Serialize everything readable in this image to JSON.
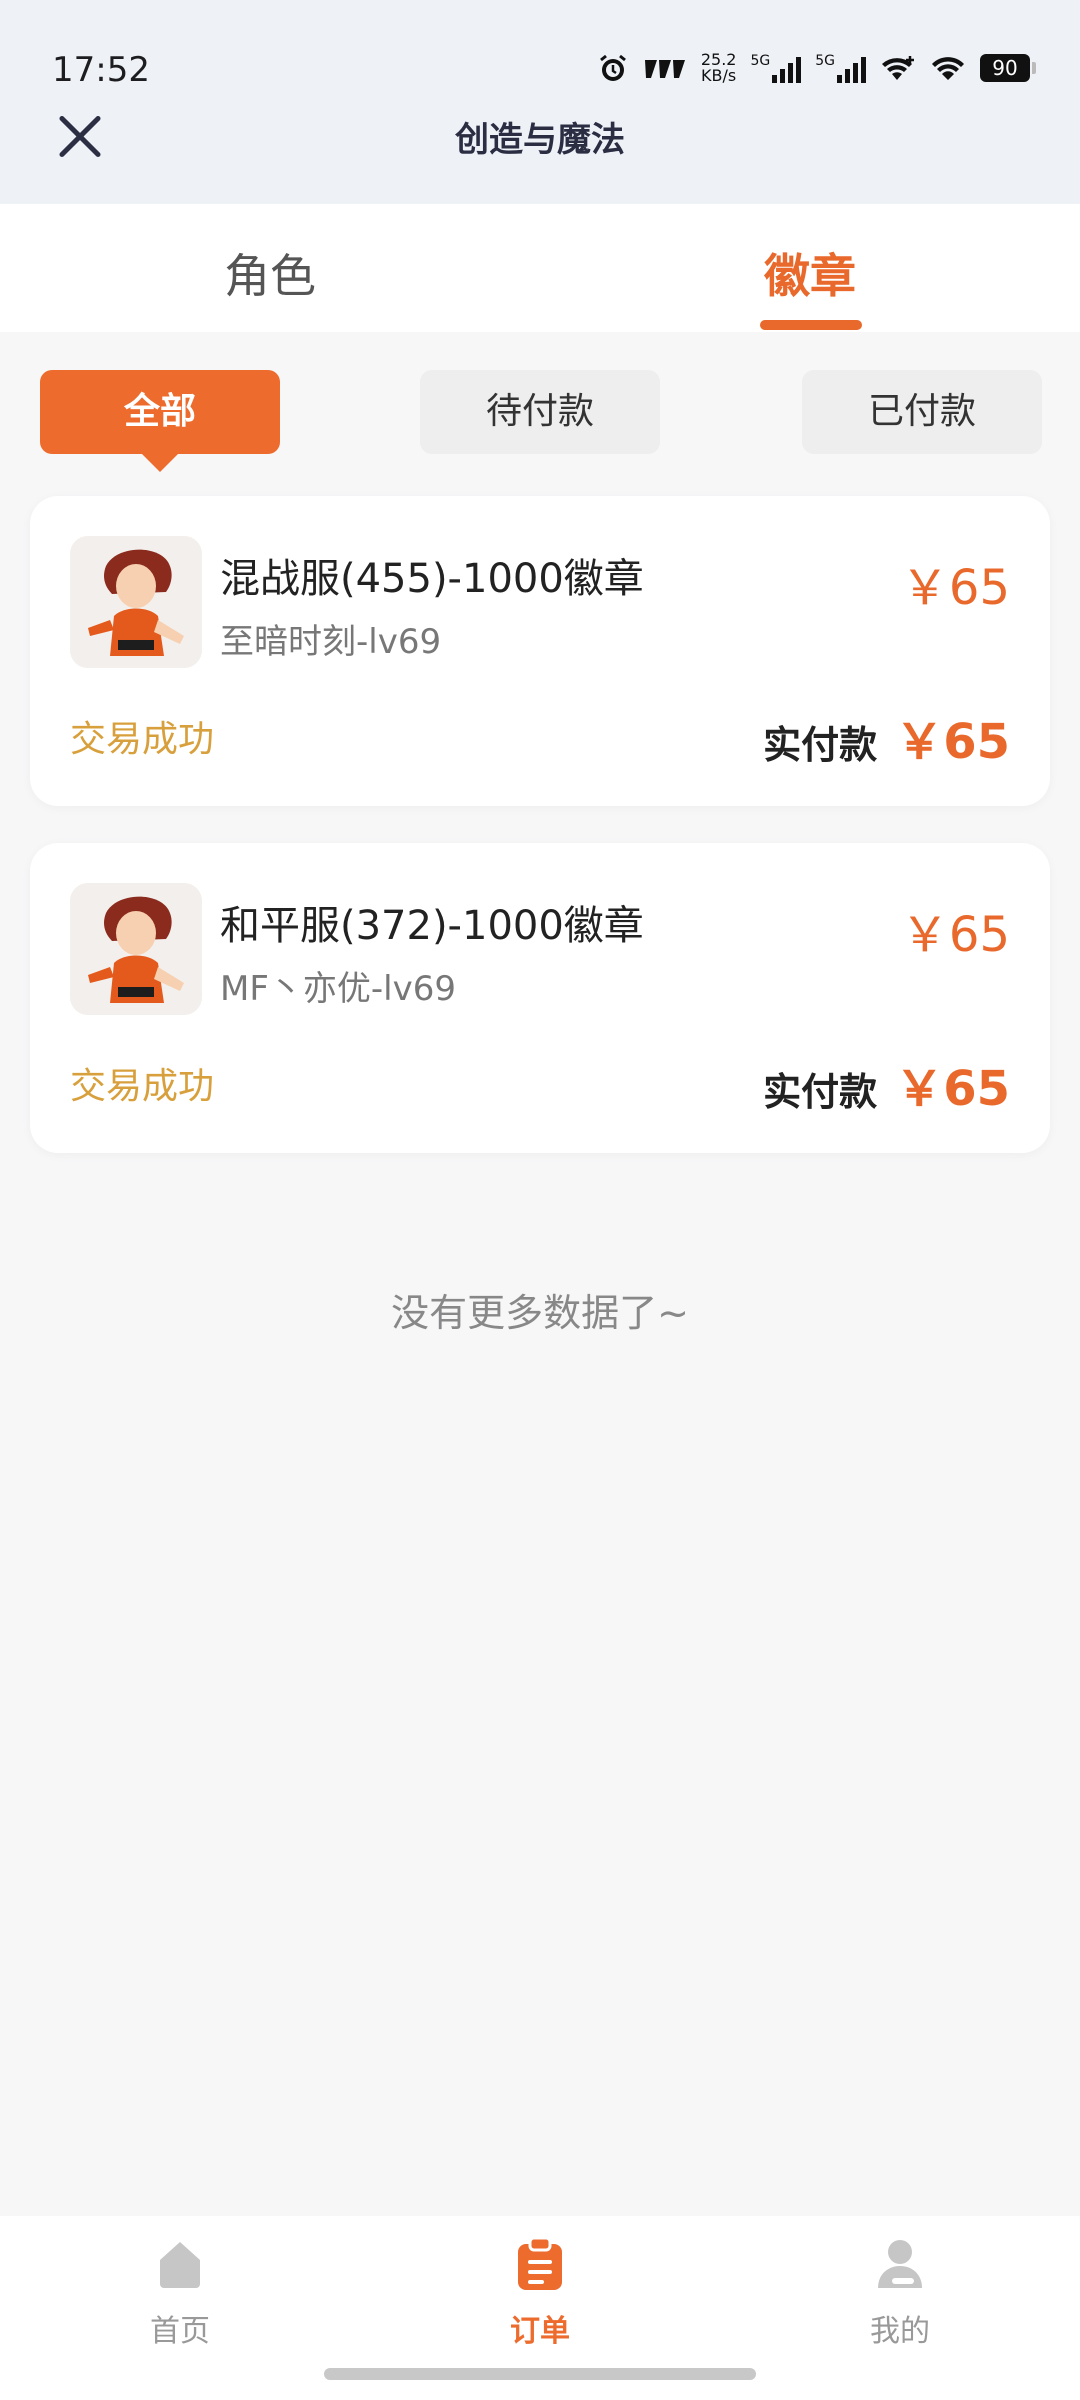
{
  "status_bar": {
    "time": "17:52",
    "net_speed_value": "25.2",
    "net_speed_unit": "KB/s",
    "sim1": "5G",
    "sim2": "5G",
    "battery": "90"
  },
  "header": {
    "title": "创造与魔法"
  },
  "tabs": [
    {
      "label": "角色",
      "active": false
    },
    {
      "label": "徽章",
      "active": true
    }
  ],
  "filters": [
    {
      "label": "全部",
      "active": true
    },
    {
      "label": "待付款",
      "active": false
    },
    {
      "label": "已付款",
      "active": false
    }
  ],
  "orders": [
    {
      "name": "混战服(455)-1000徽章",
      "sub": "至暗时刻-lv69",
      "price": "￥65",
      "status": "交易成功",
      "paid_label": "实付款",
      "paid_value": "￥65"
    },
    {
      "name": "和平服(372)-1000徽章",
      "sub": "MF丶亦优-lv69",
      "price": "￥65",
      "status": "交易成功",
      "paid_label": "实付款",
      "paid_value": "￥65"
    }
  ],
  "empty_hint": "没有更多数据了~",
  "bottom_nav": [
    {
      "label": "首页",
      "icon": "home-icon",
      "active": false
    },
    {
      "label": "订单",
      "icon": "order-icon",
      "active": true
    },
    {
      "label": "我的",
      "icon": "profile-icon",
      "active": false
    }
  ],
  "colors": {
    "accent": "#ec6b2d",
    "status_success": "#d8a03c",
    "header_bg": "#eef2f7"
  }
}
